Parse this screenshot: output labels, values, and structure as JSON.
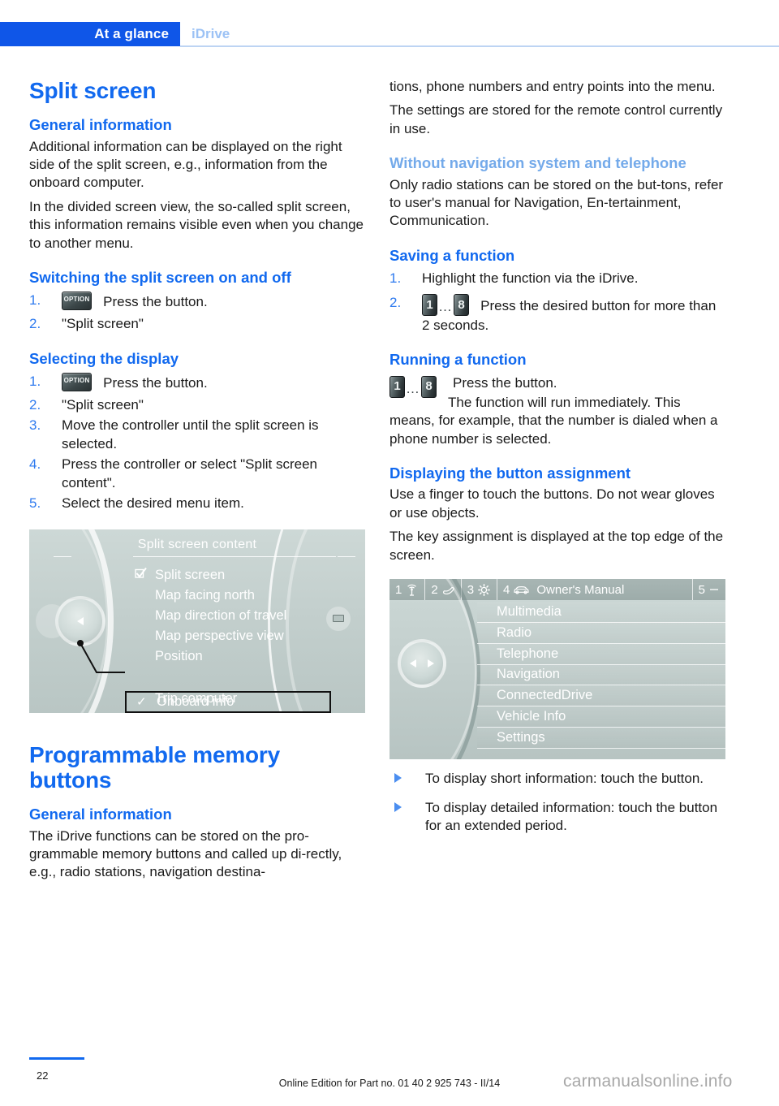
{
  "header": {
    "active_tab": "At a glance",
    "inactive_tab": "iDrive"
  },
  "left": {
    "title": "Split screen",
    "general_information_heading": "General information",
    "p1": "Additional information can be displayed on the right side of the split screen, e.g., information from the onboard computer.",
    "p2": "In the divided screen view, the so-called split screen, this information remains visible even when you change to another menu.",
    "switching_heading": "Switching the split screen on and off",
    "switching_steps": [
      {
        "num": "1.",
        "icon": "OPTION",
        "text": "Press the button."
      },
      {
        "num": "2.",
        "text": "\"Split screen\""
      }
    ],
    "selecting_heading": "Selecting the display",
    "selecting_steps": [
      {
        "num": "1.",
        "icon": "OPTION",
        "text": "Press the button."
      },
      {
        "num": "2.",
        "text": "\"Split screen\""
      },
      {
        "num": "3.",
        "text": "Move the controller until the split screen is selected."
      },
      {
        "num": "4.",
        "text": "Press the controller or select \"Split screen content\"."
      },
      {
        "num": "5.",
        "text": "Select the desired menu item."
      }
    ],
    "idrive_screenshot": {
      "title": "Split screen content",
      "items": [
        {
          "label": "Split screen",
          "check": "checkbox-checked"
        },
        {
          "label": "Map facing north",
          "check": ""
        },
        {
          "label": "Map direction of travel",
          "check": ""
        },
        {
          "label": "Map perspective view",
          "check": ""
        },
        {
          "label": "Position",
          "check": ""
        },
        {
          "label": "Trip computer",
          "check": ""
        }
      ],
      "highlighted_item": {
        "label": "Onboard info",
        "check": "✓"
      }
    },
    "memory_title": "Programmable memory buttons",
    "memory_general_heading": "General information",
    "memory_p1": "The iDrive functions can be stored on the pro‐grammable memory buttons and called up di‐rectly, e.g., radio stations, navigation destina‐"
  },
  "right": {
    "cont_p1": "tions, phone numbers and entry points into the menu.",
    "cont_p2": "The settings are stored for the remote control currently in use.",
    "without_nav_heading": "Without navigation system and telephone",
    "without_nav_p": "Only radio stations can be stored on the but‐tons, refer to user's manual for Navigation, En‐tertainment, Communication.",
    "saving_heading": "Saving a function",
    "saving_steps": [
      {
        "num": "1.",
        "text": "Highlight the function via the iDrive."
      },
      {
        "num": "2.",
        "icon": "1...8",
        "text": "Press the desired button for more than 2 seconds."
      }
    ],
    "running_heading": "Running a function",
    "running_line1": "Press the button.",
    "running_line2": "The function will run immediately. This means, for example, that the number is dialed when a phone number is selected.",
    "displaying_heading": "Displaying the button assignment",
    "displaying_p1": "Use a finger to touch the buttons. Do not wear gloves or use objects.",
    "displaying_p2": "The key assignment is displayed at the top edge of the screen.",
    "idrive_screenshot": {
      "topbar": [
        {
          "num": "1",
          "icon": "antenna-icon"
        },
        {
          "num": "2",
          "icon": "phone-handset-icon"
        },
        {
          "num": "3",
          "icon": "gear-icon"
        },
        {
          "num": "4",
          "icon": "car-icon",
          "label": "Owner's Manual"
        },
        {
          "num": "5",
          "icon": "dash-icon"
        }
      ],
      "menu_items": [
        "Multimedia",
        "Radio",
        "Telephone",
        "Navigation",
        "ConnectedDrive",
        "Vehicle Info",
        "Settings"
      ]
    },
    "bullets": [
      "To display short information: touch the button.",
      "To display detailed information: touch the button for an extended period."
    ]
  },
  "footer": {
    "page_number": "22",
    "edition": "Online Edition for Part no. 01 40 2 925 743 - II/14",
    "watermark": "carmanualsonline.info"
  },
  "memory_button_labels": {
    "first": "1",
    "last": "8",
    "dots": "…"
  },
  "colors": {
    "accent_blue": "#1169ef",
    "tab_blue": "#0f56e8",
    "light_blue": "#74aaea",
    "screen_gray": "#c3cfcd"
  }
}
